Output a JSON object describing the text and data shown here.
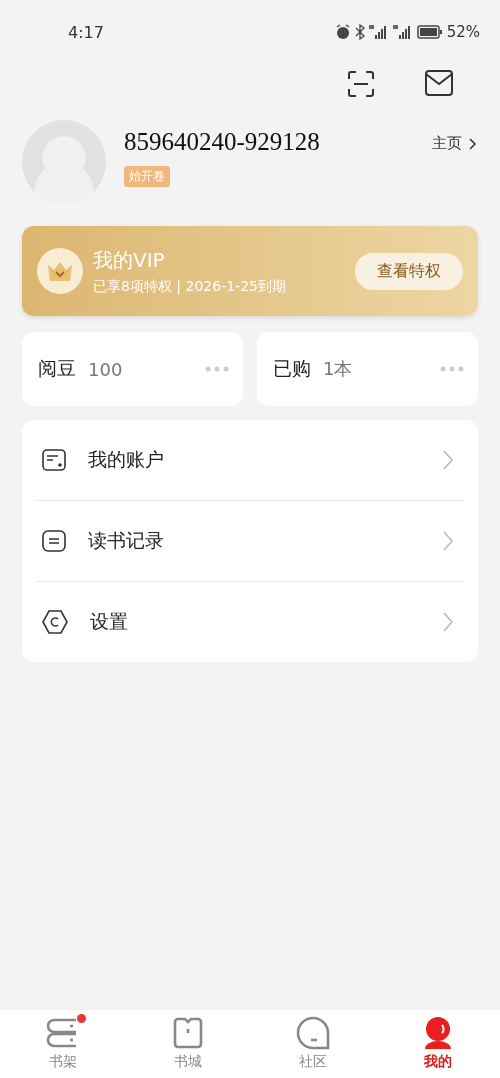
{
  "status_bar": {
    "time": "4:17",
    "battery": "52%"
  },
  "profile": {
    "name": "859640240-929128",
    "badge": "始开卷",
    "home_link": "主页"
  },
  "vip": {
    "title": "我的VIP",
    "subtitle": "已享8项特权 | 2026-1-25到期",
    "button": "查看特权"
  },
  "stats": [
    {
      "label": "阅豆",
      "value": "100"
    },
    {
      "label": "已购",
      "value": "1本"
    }
  ],
  "menu": [
    {
      "kind": "account",
      "label": "我的账户"
    },
    {
      "kind": "history",
      "label": "读书记录"
    },
    {
      "kind": "settings",
      "label": "设置"
    }
  ],
  "tabs": [
    {
      "kind": "shelf",
      "label": "书架",
      "selected": false,
      "dot": true
    },
    {
      "kind": "store",
      "label": "书城",
      "selected": false,
      "dot": false
    },
    {
      "kind": "community",
      "label": "社区",
      "selected": false,
      "dot": false
    },
    {
      "kind": "me",
      "label": "我的",
      "selected": true,
      "dot": false
    }
  ]
}
